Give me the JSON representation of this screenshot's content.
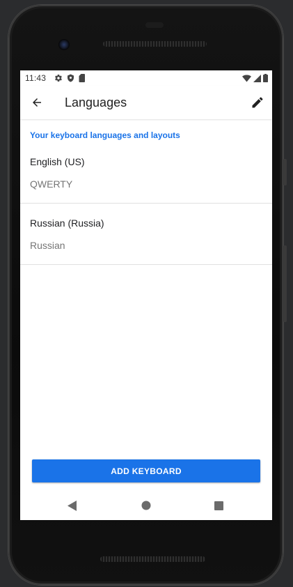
{
  "status_bar": {
    "time": "11:43",
    "left_icons": [
      "settings-icon",
      "shield-icon",
      "sd-card-icon"
    ],
    "right_icons": [
      "wifi-icon",
      "signal-icon",
      "battery-icon"
    ]
  },
  "app_bar": {
    "title": "Languages",
    "back_icon": "arrow-back-icon",
    "edit_icon": "pencil-icon"
  },
  "section_header": "Your keyboard languages and layouts",
  "languages": [
    {
      "name": "English (US)",
      "layout": "QWERTY"
    },
    {
      "name": "Russian (Russia)",
      "layout": "Russian"
    }
  ],
  "add_button": {
    "label": "ADD KEYBOARD"
  },
  "nav_bar": {
    "buttons": [
      "back-triangle-icon",
      "home-circle-icon",
      "recents-square-icon"
    ]
  },
  "colors": {
    "accent": "#1a73e8",
    "title_text": "#212121",
    "secondary_text": "#757575",
    "divider": "#e0e0e0"
  }
}
